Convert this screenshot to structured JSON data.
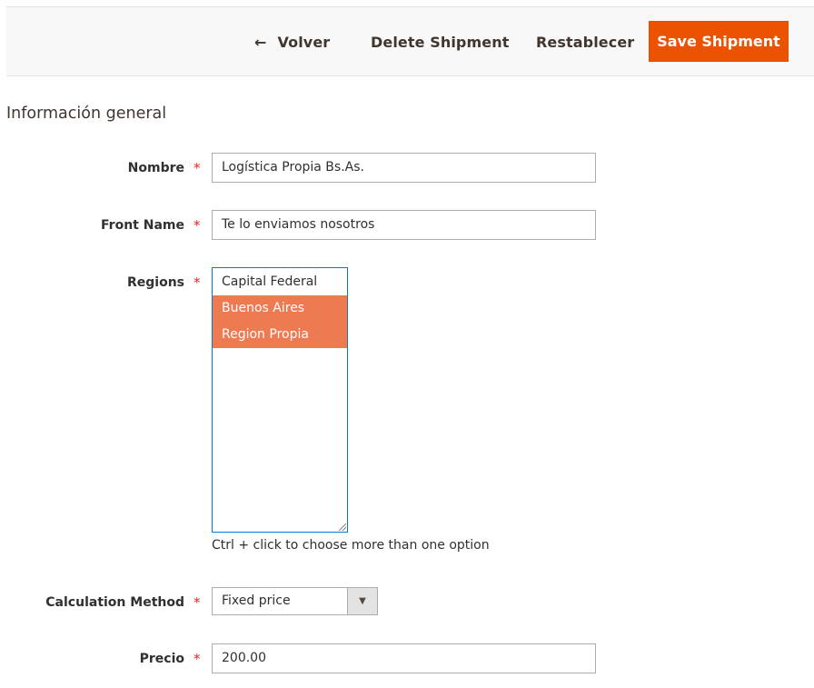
{
  "toolbar": {
    "back_icon": "arrow-left-icon",
    "back_arrow": "←",
    "back_label": "Volver",
    "delete_label": "Delete Shipment",
    "reset_label": "Restablecer",
    "save_label": "Save Shipment"
  },
  "section": {
    "title": "Información general"
  },
  "form": {
    "required_mark": "*",
    "nombre": {
      "label": "Nombre",
      "value": "Logística Propia Bs.As."
    },
    "front_name": {
      "label": "Front Name",
      "value": "Te lo enviamos nosotros"
    },
    "regions": {
      "label": "Regions",
      "options": [
        {
          "label": "Capital Federal",
          "selected": false
        },
        {
          "label": "Buenos Aires",
          "selected": true
        },
        {
          "label": "Region Propia",
          "selected": true
        }
      ],
      "note": "Ctrl + click to choose more than one option"
    },
    "calculation_method": {
      "label": "Calculation Method",
      "value": "Fixed price",
      "arrow": "▼"
    },
    "precio": {
      "label": "Precio",
      "value": "200.00"
    }
  },
  "colors": {
    "primary_button": "#eb5202",
    "selected_option": "#ee7a52",
    "required": "#e22626",
    "focus_border": "#007bdb"
  }
}
